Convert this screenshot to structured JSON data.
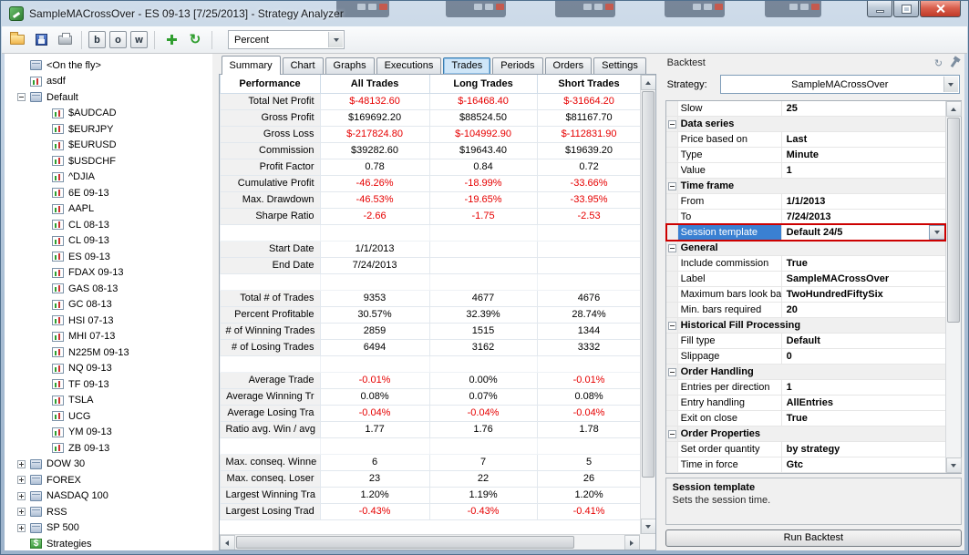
{
  "window": {
    "title": "SampleMACrossOver - ES 09-13 [7/25/2013] - Strategy Analyzer"
  },
  "colors": {
    "negative": "#e60000",
    "selection": "#3a80d2",
    "annotation": "#cc0000"
  },
  "toolbar": {
    "letters": [
      "b",
      "o",
      "w"
    ],
    "display_selector": "Percent"
  },
  "tree": {
    "items": [
      {
        "label": "<On the fly>",
        "level": 1,
        "expand": "none",
        "icon": "folder"
      },
      {
        "label": "asdf",
        "level": 1,
        "expand": "none",
        "icon": "chart"
      },
      {
        "label": "Default",
        "level": 1,
        "expand": "minus",
        "icon": "folder"
      },
      {
        "label": "$AUDCAD",
        "level": 2,
        "expand": "none",
        "icon": "chart"
      },
      {
        "label": "$EURJPY",
        "level": 2,
        "expand": "none",
        "icon": "chart"
      },
      {
        "label": "$EURUSD",
        "level": 2,
        "expand": "none",
        "icon": "chart"
      },
      {
        "label": "$USDCHF",
        "level": 2,
        "expand": "none",
        "icon": "chart"
      },
      {
        "label": "^DJIA",
        "level": 2,
        "expand": "none",
        "icon": "chart"
      },
      {
        "label": "6E 09-13",
        "level": 2,
        "expand": "none",
        "icon": "chart"
      },
      {
        "label": "AAPL",
        "level": 2,
        "expand": "none",
        "icon": "chart"
      },
      {
        "label": "CL 08-13",
        "level": 2,
        "expand": "none",
        "icon": "chart"
      },
      {
        "label": "CL 09-13",
        "level": 2,
        "expand": "none",
        "icon": "chart"
      },
      {
        "label": "ES 09-13",
        "level": 2,
        "expand": "none",
        "icon": "chart"
      },
      {
        "label": "FDAX 09-13",
        "level": 2,
        "expand": "none",
        "icon": "chart"
      },
      {
        "label": "GAS 08-13",
        "level": 2,
        "expand": "none",
        "icon": "chart"
      },
      {
        "label": "GC 08-13",
        "level": 2,
        "expand": "none",
        "icon": "chart"
      },
      {
        "label": "HSI 07-13",
        "level": 2,
        "expand": "none",
        "icon": "chart"
      },
      {
        "label": "MHI 07-13",
        "level": 2,
        "expand": "none",
        "icon": "chart"
      },
      {
        "label": "N225M 09-13",
        "level": 2,
        "expand": "none",
        "icon": "chart"
      },
      {
        "label": "NQ 09-13",
        "level": 2,
        "expand": "none",
        "icon": "chart"
      },
      {
        "label": "TF 09-13",
        "level": 2,
        "expand": "none",
        "icon": "chart"
      },
      {
        "label": "TSLA",
        "level": 2,
        "expand": "none",
        "icon": "chart"
      },
      {
        "label": "UCG",
        "level": 2,
        "expand": "none",
        "icon": "chart"
      },
      {
        "label": "YM 09-13",
        "level": 2,
        "expand": "none",
        "icon": "chart"
      },
      {
        "label": "ZB 09-13",
        "level": 2,
        "expand": "none",
        "icon": "chart"
      },
      {
        "label": "DOW 30",
        "level": 1,
        "expand": "plus",
        "icon": "folder"
      },
      {
        "label": "FOREX",
        "level": 1,
        "expand": "plus",
        "icon": "folder"
      },
      {
        "label": "NASDAQ 100",
        "level": 1,
        "expand": "plus",
        "icon": "folder"
      },
      {
        "label": "RSS",
        "level": 1,
        "expand": "plus",
        "icon": "folder"
      },
      {
        "label": "SP 500",
        "level": 1,
        "expand": "plus",
        "icon": "folder"
      },
      {
        "label": "Strategies",
        "level": 1,
        "expand": "none",
        "icon": "strategy"
      }
    ]
  },
  "center": {
    "tabs": [
      {
        "label": "Summary",
        "state": "active"
      },
      {
        "label": "Chart",
        "state": "normal"
      },
      {
        "label": "Graphs",
        "state": "normal"
      },
      {
        "label": "Executions",
        "state": "normal"
      },
      {
        "label": "Trades",
        "state": "highlight"
      },
      {
        "label": "Periods",
        "state": "normal"
      },
      {
        "label": "Orders",
        "state": "normal"
      },
      {
        "label": "Settings",
        "state": "normal"
      }
    ]
  },
  "table": {
    "headers": [
      "Performance",
      "All Trades",
      "Long Trades",
      "Short Trades"
    ],
    "rows": [
      {
        "label": "Total Net Profit",
        "values": [
          "$-48132.60",
          "$-16468.40",
          "$-31664.20"
        ]
      },
      {
        "label": "Gross Profit",
        "values": [
          "$169692.20",
          "$88524.50",
          "$81167.70"
        ]
      },
      {
        "label": "Gross Loss",
        "values": [
          "$-217824.80",
          "$-104992.90",
          "$-112831.90"
        ]
      },
      {
        "label": "Commission",
        "values": [
          "$39282.60",
          "$19643.40",
          "$19639.20"
        ]
      },
      {
        "label": "Profit Factor",
        "values": [
          "0.78",
          "0.84",
          "0.72"
        ]
      },
      {
        "label": "Cumulative Profit",
        "values": [
          "-46.26%",
          "-18.99%",
          "-33.66%"
        ]
      },
      {
        "label": "Max. Drawdown",
        "values": [
          "-46.53%",
          "-19.65%",
          "-33.95%"
        ]
      },
      {
        "label": "Sharpe Ratio",
        "values": [
          "-2.66",
          "-1.75",
          "-2.53"
        ]
      },
      {
        "blank": true
      },
      {
        "label": "Start Date",
        "values": [
          "1/1/2013",
          "",
          ""
        ]
      },
      {
        "label": "End Date",
        "values": [
          "7/24/2013",
          "",
          ""
        ]
      },
      {
        "blank": true
      },
      {
        "label": "Total # of Trades",
        "values": [
          "9353",
          "4677",
          "4676"
        ]
      },
      {
        "label": "Percent Profitable",
        "values": [
          "30.57%",
          "32.39%",
          "28.74%"
        ]
      },
      {
        "label": "# of Winning Trades",
        "values": [
          "2859",
          "1515",
          "1344"
        ]
      },
      {
        "label": "# of Losing Trades",
        "values": [
          "6494",
          "3162",
          "3332"
        ]
      },
      {
        "blank": true
      },
      {
        "label": "Average Trade",
        "values": [
          "-0.01%",
          "0.00%",
          "-0.01%"
        ]
      },
      {
        "label": "Average Winning Tr",
        "values": [
          "0.08%",
          "0.07%",
          "0.08%"
        ]
      },
      {
        "label": "Average Losing Tra",
        "values": [
          "-0.04%",
          "-0.04%",
          "-0.04%"
        ]
      },
      {
        "label": "Ratio avg. Win / avg",
        "values": [
          "1.77",
          "1.76",
          "1.78"
        ]
      },
      {
        "blank": true
      },
      {
        "label": "Max. conseq. Winne",
        "values": [
          "6",
          "7",
          "5"
        ]
      },
      {
        "label": "Max. conseq. Loser",
        "values": [
          "23",
          "22",
          "26"
        ]
      },
      {
        "label": "Largest Winning Tra",
        "values": [
          "1.20%",
          "1.19%",
          "1.20%"
        ]
      },
      {
        "label": "Largest Losing Trad",
        "values": [
          "-0.43%",
          "-0.43%",
          "-0.41%"
        ]
      }
    ]
  },
  "backtest": {
    "title": "Backtest",
    "strategy_label": "Strategy:",
    "strategy_value": "SampleMACrossOver",
    "properties": [
      {
        "type": "row",
        "label": "Slow",
        "value": "25"
      },
      {
        "type": "group",
        "label": "Data series"
      },
      {
        "type": "row",
        "label": "Price based on",
        "value": "Last"
      },
      {
        "type": "row",
        "label": "Type",
        "value": "Minute"
      },
      {
        "type": "row",
        "label": "Value",
        "value": "1"
      },
      {
        "type": "group",
        "label": "Time frame"
      },
      {
        "type": "row",
        "label": "From",
        "value": "1/1/2013"
      },
      {
        "type": "row",
        "label": "To",
        "value": "7/24/2013"
      },
      {
        "type": "row",
        "label": "Session template",
        "value": "Default 24/5",
        "selected": true,
        "dropdown": true,
        "annotated": true
      },
      {
        "type": "group",
        "label": "General"
      },
      {
        "type": "row",
        "label": "Include commission",
        "value": "True"
      },
      {
        "type": "row",
        "label": "Label",
        "value": "SampleMACrossOver"
      },
      {
        "type": "row",
        "label": "Maximum bars look back",
        "value": "TwoHundredFiftySix"
      },
      {
        "type": "row",
        "label": "Min. bars required",
        "value": "20"
      },
      {
        "type": "group",
        "label": "Historical Fill Processing"
      },
      {
        "type": "row",
        "label": "Fill type",
        "value": "Default"
      },
      {
        "type": "row",
        "label": "Slippage",
        "value": "0"
      },
      {
        "type": "group",
        "label": "Order Handling"
      },
      {
        "type": "row",
        "label": "Entries per direction",
        "value": "1"
      },
      {
        "type": "row",
        "label": "Entry handling",
        "value": "AllEntries"
      },
      {
        "type": "row",
        "label": "Exit on close",
        "value": "True"
      },
      {
        "type": "group",
        "label": "Order Properties"
      },
      {
        "type": "row",
        "label": "Set order quantity",
        "value": "by strategy"
      },
      {
        "type": "row",
        "label": "Time in force",
        "value": "Gtc"
      }
    ],
    "description_title": "Session template",
    "description_text": "Sets the session time.",
    "run_button": "Run Backtest"
  }
}
